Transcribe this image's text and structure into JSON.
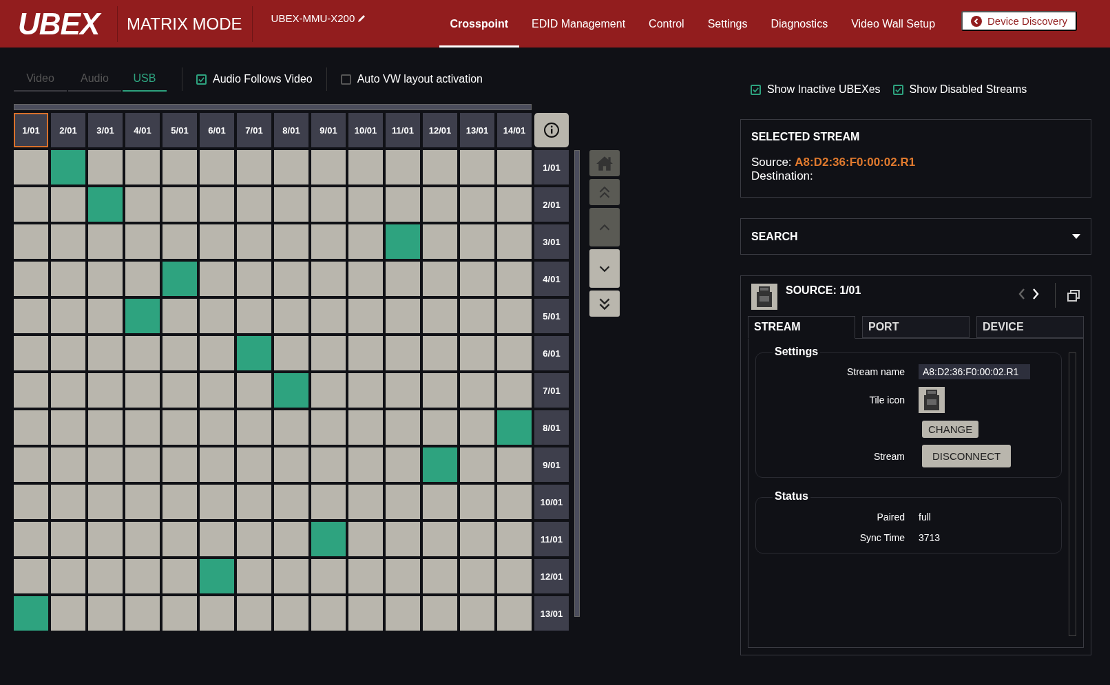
{
  "header": {
    "logo": "UBEX",
    "mode": "MATRIX MODE",
    "device_name": "UBEX-MMU-X200",
    "nav": [
      {
        "label": "Crosspoint",
        "selected": true
      },
      {
        "label": "EDID Management",
        "selected": false
      },
      {
        "label": "Control",
        "selected": false
      },
      {
        "label": "Settings",
        "selected": false
      },
      {
        "label": "Diagnostics",
        "selected": false
      },
      {
        "label": "Video Wall Setup",
        "selected": false
      }
    ],
    "discovery_button": "Device Discovery"
  },
  "toolbar": {
    "tabs": [
      {
        "label": "Video",
        "selected": false
      },
      {
        "label": "Audio",
        "selected": false
      },
      {
        "label": "USB",
        "selected": true
      }
    ],
    "options": [
      {
        "label": "Audio Follows Video",
        "checked": true
      },
      {
        "label": "Auto VW layout activation",
        "checked": false
      }
    ],
    "right_options": [
      {
        "label": "Show Inactive UBEXes",
        "checked": true
      },
      {
        "label": "Show Disabled Streams",
        "checked": true
      }
    ]
  },
  "matrix": {
    "columns": [
      {
        "label": "1/01",
        "selected": true
      },
      {
        "label": "2/01",
        "selected": false
      },
      {
        "label": "3/01",
        "selected": false
      },
      {
        "label": "4/01",
        "selected": false
      },
      {
        "label": "5/01",
        "selected": false
      },
      {
        "label": "6/01",
        "selected": false
      },
      {
        "label": "7/01",
        "selected": false
      },
      {
        "label": "8/01",
        "selected": false
      },
      {
        "label": "9/01",
        "selected": false
      },
      {
        "label": "10/01",
        "selected": false
      },
      {
        "label": "11/01",
        "selected": false
      },
      {
        "label": "12/01",
        "selected": false
      },
      {
        "label": "13/01",
        "selected": false
      },
      {
        "label": "14/01",
        "selected": false
      }
    ],
    "rows": [
      {
        "label": "1/01",
        "cells": [
          false,
          true,
          false,
          false,
          false,
          false,
          false,
          false,
          false,
          false,
          false,
          false,
          false,
          false
        ]
      },
      {
        "label": "2/01",
        "cells": [
          false,
          false,
          true,
          false,
          false,
          false,
          false,
          false,
          false,
          false,
          false,
          false,
          false,
          false
        ]
      },
      {
        "label": "3/01",
        "cells": [
          false,
          false,
          false,
          false,
          false,
          false,
          false,
          false,
          false,
          false,
          true,
          false,
          false,
          false
        ]
      },
      {
        "label": "4/01",
        "cells": [
          false,
          false,
          false,
          false,
          true,
          false,
          false,
          false,
          false,
          false,
          false,
          false,
          false,
          false
        ]
      },
      {
        "label": "5/01",
        "cells": [
          false,
          false,
          false,
          true,
          false,
          false,
          false,
          false,
          false,
          false,
          false,
          false,
          false,
          false
        ]
      },
      {
        "label": "6/01",
        "cells": [
          false,
          false,
          false,
          false,
          false,
          false,
          true,
          false,
          false,
          false,
          false,
          false,
          false,
          false
        ]
      },
      {
        "label": "7/01",
        "cells": [
          false,
          false,
          false,
          false,
          false,
          false,
          false,
          true,
          false,
          false,
          false,
          false,
          false,
          false
        ]
      },
      {
        "label": "8/01",
        "cells": [
          false,
          false,
          false,
          false,
          false,
          false,
          false,
          false,
          false,
          false,
          false,
          false,
          false,
          true
        ]
      },
      {
        "label": "9/01",
        "cells": [
          false,
          false,
          false,
          false,
          false,
          false,
          false,
          false,
          false,
          false,
          false,
          true,
          false,
          false
        ]
      },
      {
        "label": "10/01",
        "cells": [
          false,
          false,
          false,
          false,
          false,
          false,
          false,
          false,
          false,
          false,
          false,
          false,
          false,
          false
        ]
      },
      {
        "label": "11/01",
        "cells": [
          false,
          false,
          false,
          false,
          false,
          false,
          false,
          false,
          true,
          false,
          false,
          false,
          false,
          false
        ]
      },
      {
        "label": "12/01",
        "cells": [
          false,
          false,
          false,
          false,
          false,
          true,
          false,
          false,
          false,
          false,
          false,
          false,
          false,
          false
        ]
      },
      {
        "label": "13/01",
        "cells": [
          true,
          false,
          false,
          false,
          false,
          false,
          false,
          false,
          false,
          false,
          false,
          false,
          false,
          false
        ]
      }
    ],
    "nav_buttons": [
      {
        "kind": "home",
        "disabled": true
      },
      {
        "kind": "page-up",
        "disabled": true
      },
      {
        "kind": "up",
        "disabled": true
      },
      {
        "kind": "down",
        "disabled": false
      },
      {
        "kind": "page-down",
        "disabled": false
      }
    ]
  },
  "selected_stream": {
    "title": "SELECTED STREAM",
    "source_label": "Source:",
    "source_value": "A8:D2:36:F0:00:02.R1",
    "destination_label": "Destination:"
  },
  "search": {
    "title": "SEARCH"
  },
  "source_panel": {
    "title": "SOURCE: 1/01",
    "tabs": [
      {
        "label": "STREAM",
        "selected": true
      },
      {
        "label": "PORT",
        "selected": false
      },
      {
        "label": "DEVICE",
        "selected": false
      }
    ],
    "settings": {
      "title": "Settings",
      "stream_name_label": "Stream name",
      "stream_name": "A8:D2:36:F0:00:02.R1",
      "tile_icon_label": "Tile icon",
      "change_button": "CHANGE",
      "stream_label": "Stream",
      "disconnect_button": "DISCONNECT"
    },
    "status": {
      "title": "Status",
      "rows": [
        {
          "label": "Paired",
          "value": "full"
        },
        {
          "label": "Sync Time",
          "value": "3713"
        }
      ]
    }
  }
}
